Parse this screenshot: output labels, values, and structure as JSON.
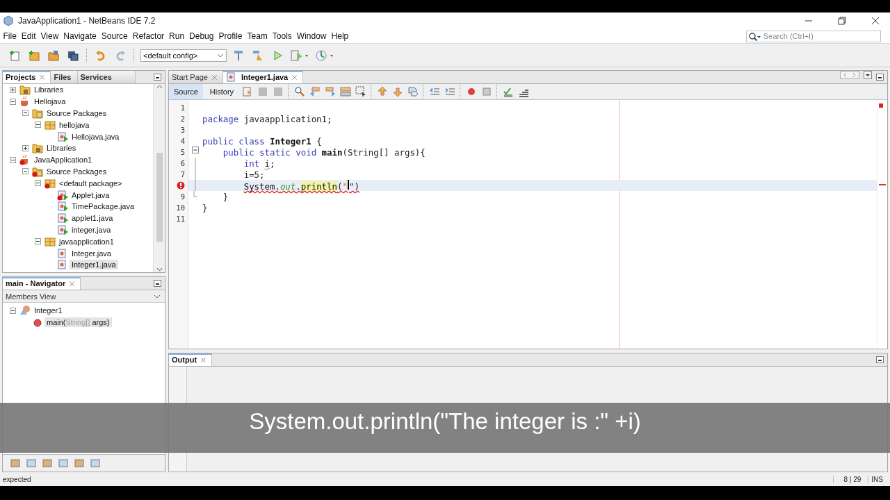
{
  "window": {
    "title": "JavaApplication1 - NetBeans IDE 7.2"
  },
  "menu": [
    "File",
    "Edit",
    "View",
    "Navigate",
    "Source",
    "Refactor",
    "Run",
    "Debug",
    "Profile",
    "Team",
    "Tools",
    "Window",
    "Help"
  ],
  "search": {
    "placeholder": "Search (Ctrl+I)"
  },
  "toolbar": {
    "config": "<default config>"
  },
  "projects_panel": {
    "tabs": [
      {
        "label": "Projects",
        "selected": true
      },
      {
        "label": "Files",
        "selected": false
      },
      {
        "label": "Services",
        "selected": false
      }
    ],
    "tree": [
      {
        "label": "Libraries",
        "kind": "libraries",
        "expanded": false,
        "selected": false,
        "error": false
      },
      {
        "label": "Hellojava",
        "kind": "project",
        "expanded": true,
        "selected": false,
        "error": false,
        "children": [
          {
            "label": "Source Packages",
            "kind": "source-packages",
            "expanded": true,
            "selected": false,
            "error": false,
            "children": [
              {
                "label": "hellojava",
                "kind": "package",
                "expanded": true,
                "selected": false,
                "error": false,
                "children": [
                  {
                    "label": "Hellojava.java",
                    "kind": "java-file",
                    "main_class": true,
                    "selected": false,
                    "error": false
                  }
                ]
              }
            ]
          },
          {
            "label": "Libraries",
            "kind": "libraries",
            "expanded": false,
            "selected": false,
            "error": false
          }
        ]
      },
      {
        "label": "JavaApplication1",
        "kind": "project",
        "expanded": true,
        "selected": false,
        "error": true,
        "children": [
          {
            "label": "Source Packages",
            "kind": "source-packages",
            "expanded": true,
            "selected": false,
            "error": true,
            "children": [
              {
                "label": "<default package>",
                "kind": "package",
                "expanded": true,
                "selected": false,
                "error": true,
                "children": [
                  {
                    "label": "Applet.java",
                    "kind": "java-file",
                    "main_class": true,
                    "selected": false,
                    "error": true
                  },
                  {
                    "label": "TimePackage.java",
                    "kind": "java-file",
                    "main_class": true,
                    "selected": false,
                    "error": false
                  },
                  {
                    "label": "applet1.java",
                    "kind": "java-file",
                    "main_class": true,
                    "selected": false,
                    "error": false
                  },
                  {
                    "label": "integer.java",
                    "kind": "java-file",
                    "main_class": true,
                    "selected": false,
                    "error": false
                  }
                ]
              },
              {
                "label": "javaapplication1",
                "kind": "package",
                "expanded": true,
                "selected": false,
                "error": false,
                "children": [
                  {
                    "label": "Integer.java",
                    "kind": "java-file",
                    "main_class": false,
                    "selected": false,
                    "error": false
                  },
                  {
                    "label": "Integer1.java",
                    "kind": "java-file",
                    "main_class": false,
                    "selected": true,
                    "error": false
                  }
                ]
              }
            ]
          }
        ]
      }
    ]
  },
  "navigator": {
    "title": "main - Navigator",
    "view": "Members View",
    "tree": [
      {
        "kind": "class",
        "expanded": true,
        "selected": false,
        "parts": [
          {
            "text": "Integer1",
            "dim": false
          }
        ],
        "children": [
          {
            "kind": "method",
            "selected": true,
            "parts": [
              {
                "text": "main(",
                "dim": false
              },
              {
                "text": "String[]",
                "dim": true
              },
              {
                "text": " args)",
                "dim": false
              }
            ]
          }
        ]
      }
    ]
  },
  "editor": {
    "tabs": [
      {
        "label": "Start Page",
        "selected": false
      },
      {
        "label": "Integer1.java",
        "selected": true
      }
    ],
    "views": [
      {
        "label": "Source",
        "selected": true
      },
      {
        "label": "History",
        "selected": false
      }
    ],
    "lines": [
      {
        "number": "1",
        "error": false,
        "current": false
      },
      {
        "number": "2",
        "error": false,
        "current": false,
        "tokens": [
          {
            "text": "package ",
            "kind": "keyword"
          },
          {
            "text": "javaapplication1;",
            "kind": "plain"
          }
        ]
      },
      {
        "number": "3",
        "error": false,
        "current": false
      },
      {
        "number": "4",
        "error": false,
        "current": false,
        "tokens": [
          {
            "text": "public class ",
            "kind": "keyword"
          },
          {
            "text": "Integer1",
            "kind": "bold"
          },
          {
            "text": " {",
            "kind": "plain"
          }
        ]
      },
      {
        "number": "5",
        "error": false,
        "current": false,
        "fold": {
          "kind": "start"
        },
        "tokens": [
          {
            "text": "    public static void ",
            "kind": "keyword"
          },
          {
            "text": "main",
            "kind": "bold"
          },
          {
            "text": "(String[] args){",
            "kind": "plain"
          }
        ]
      },
      {
        "number": "6",
        "error": false,
        "current": false,
        "fold": {
          "kind": "inside"
        },
        "tokens": [
          {
            "text": "        int ",
            "kind": "keyword"
          },
          {
            "text": "i",
            "kind": "warning"
          },
          {
            "text": ";",
            "kind": "plain"
          }
        ]
      },
      {
        "number": "7",
        "error": false,
        "current": false,
        "fold": {
          "kind": "inside"
        },
        "tokens": [
          {
            "text": "        i=5;",
            "kind": "plain"
          }
        ]
      },
      {
        "error": true,
        "current": true,
        "fold": {
          "kind": "inside"
        },
        "tokens": [
          {
            "text": "        System.",
            "kind": "error"
          },
          {
            "text": "out",
            "kind": "field-error"
          },
          {
            "text": ".",
            "kind": "error"
          },
          {
            "text": "println",
            "kind": "highlight-error"
          },
          {
            "text": "(",
            "kind": "error"
          },
          {
            "text": "\"",
            "kind": "string-error"
          },
          {
            "kind": "caret"
          },
          {
            "text": "\")",
            "kind": "error"
          }
        ]
      },
      {
        "number": "9",
        "error": false,
        "current": false,
        "fold": {
          "kind": "end"
        },
        "tokens": [
          {
            "text": "    }",
            "kind": "plain"
          }
        ]
      },
      {
        "number": "10",
        "error": false,
        "current": false,
        "tokens": [
          {
            "text": "}",
            "kind": "plain"
          }
        ]
      },
      {
        "number": "11",
        "error": false,
        "current": false
      }
    ]
  },
  "output": {
    "title": "Output"
  },
  "caption": "System.out.println(\"The integer is :\" +i)",
  "status": {
    "message": "expected",
    "position": "8 | 29",
    "mode": "INS"
  }
}
